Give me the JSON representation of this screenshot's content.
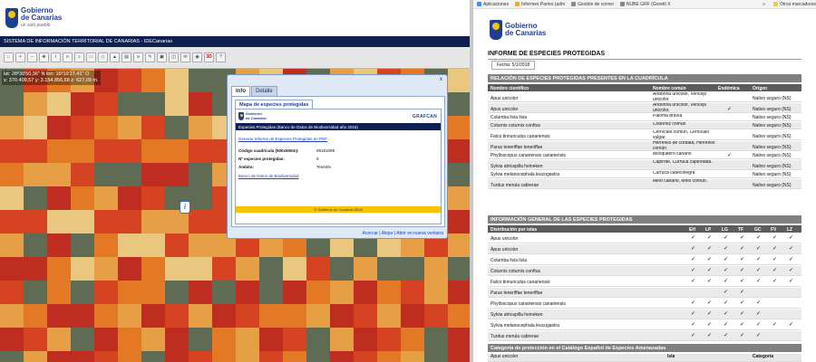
{
  "left_app": {
    "logo": {
      "line1": "Gobierno",
      "line2": "de Canarias",
      "tagline": "un solo pueblo"
    },
    "system_bar": "SISTEMA DE INFORMACIÓN TERRITORIAL DE CANARIAS - IDECanarias",
    "coords": {
      "line1": "lat: 28º30'50,36'' N  lon: 16º19'27,41'' O",
      "line2": "x: 370.409,57  y: 3.154.856,68  z: 627,09 m."
    },
    "toolbar_3d": "3D",
    "popup": {
      "tabs": [
        "Info",
        "Detalle"
      ],
      "inner_tab": "Mapa de especies protegidas",
      "logo_line1": "Gobierno",
      "logo_line2": "de Canarias",
      "brand": "GRAFCAN",
      "banner": "Especies Protegidas (Banco de Datos de Biodiversidad año 2016)",
      "report_link": "Generar Informe de Especies Protegidas en PDF",
      "fields": [
        {
          "label": "Código cuadrícula (500x500m):",
          "value": "09181099"
        },
        {
          "label": "Nº especies protegidas:",
          "value": "9"
        },
        {
          "label": "Ámbito:",
          "value": "Tenerife"
        }
      ],
      "db_link": "Banco de Datos de Biodiversidad",
      "footer": "© Gobierno de Canarias 2018",
      "actions": "Acercar | Alejar | Abrir en nueva ventana",
      "close": "x"
    }
  },
  "browser": {
    "bookmarks": [
      "Aplicaciones",
      "Informes Partes (adm",
      "Gestión de correo",
      "NUBE GRF (Goretti X",
      "Otros marcadores"
    ],
    "more": "»"
  },
  "report": {
    "logo_line1": "Gobierno",
    "logo_line2": "de Canarias",
    "title": "INFORME DE ESPECIES PROTEGIDAS",
    "date": "Fecha: 5/1/2018",
    "section1": "RELACIÓN DE ESPECIES PROTEGIDAS PRESENTES EN LA CUADRÍCULA",
    "section1_headers": [
      "Nombre científico",
      "Nombre común",
      "Endémica",
      "Origen"
    ],
    "species": [
      {
        "sci": "Apus unicolor",
        "common": "Andoriña unicolor, Vencejo unicolor.",
        "endemic": "",
        "origin": "Nativo seguro (NS)"
      },
      {
        "sci": "Apus unicolor",
        "common": "Andoriña unicolor, Vencejo unicolor.",
        "endemic": "✓",
        "origin": "Nativo seguro (NS)"
      },
      {
        "sci": "Columba livia livia",
        "common": "Paloma bravía",
        "endemic": "",
        "origin": "Nativo seguro (NS)"
      },
      {
        "sci": "Coturnix coturnix confisa",
        "common": "Codorniz común",
        "endemic": "",
        "origin": "Nativo seguro (NS)"
      },
      {
        "sci": "Falco tinnunculus canariensis",
        "common": "Cernícalo común, Cernícalo vulgar.",
        "endemic": "",
        "origin": "Nativo seguro (NS)"
      },
      {
        "sci": "Parus teneriffae teneriffae",
        "common": "Herrerillo de corbata, Herrerillo común",
        "endemic": "",
        "origin": "Nativo seguro (NS)"
      },
      {
        "sci": "Phylloscopus canariensis canariensis",
        "common": "Mosquitero canario",
        "endemic": "✓",
        "origin": "Nativo seguro (NS)"
      },
      {
        "sci": "Sylvia atricapilla heineken",
        "common": "Capirote, Curruca capirotada.",
        "endemic": "",
        "origin": "Nativo seguro (NS)"
      },
      {
        "sci": "Sylvia melanocephala leucogastra",
        "common": "Curruca cabecinegra",
        "endemic": "",
        "origin": "Nativo seguro (NS)"
      },
      {
        "sci": "Turdus merula cabrerae",
        "common": "Mirlo canario, Mirlo común.",
        "endemic": "",
        "origin": "Nativo seguro (NS)"
      }
    ],
    "section2": "INFORMACIÓN GENERAL DE LAS ESPECIES PROTEGIDAS",
    "section2_header": "Distribución por islas",
    "islands": [
      "EH",
      "LP",
      "LG",
      "TF",
      "GC",
      "FV",
      "LZ"
    ],
    "distribution": [
      {
        "sci": "Apus unicolor",
        "marks": [
          "✓",
          "✓",
          "✓",
          "✓",
          "✓",
          "✓",
          "✓"
        ]
      },
      {
        "sci": "Apus unicolor",
        "marks": [
          "✓",
          "✓",
          "✓",
          "✓",
          "✓",
          "✓",
          "✓"
        ]
      },
      {
        "sci": "Columba livia livia",
        "marks": [
          "✓",
          "✓",
          "✓",
          "✓",
          "✓",
          "✓",
          "✓"
        ]
      },
      {
        "sci": "Coturnix coturnix confisa",
        "marks": [
          "✓",
          "✓",
          "✓",
          "✓",
          "✓",
          "✓",
          "✓"
        ]
      },
      {
        "sci": "Falco tinnunculus canariensis",
        "marks": [
          "✓",
          "✓",
          "✓",
          "✓",
          "✓",
          "✓",
          "✓"
        ]
      },
      {
        "sci": "Parus teneriffae teneriffae",
        "marks": [
          "",
          "",
          "✓",
          "✓",
          "",
          "",
          ""
        ]
      },
      {
        "sci": "Phylloscopus canariensis canariensis",
        "marks": [
          "✓",
          "✓",
          "✓",
          "✓",
          "✓",
          "",
          ""
        ]
      },
      {
        "sci": "Sylvia atricapilla heineken",
        "marks": [
          "✓",
          "✓",
          "✓",
          "✓",
          "✓",
          "",
          ""
        ]
      },
      {
        "sci": "Sylvia melanocephala leucogastra",
        "marks": [
          "✓",
          "✓",
          "✓",
          "✓",
          "✓",
          "✓",
          "✓"
        ]
      },
      {
        "sci": "Turdus merula cabrerae",
        "marks": [
          "✓",
          "✓",
          "✓",
          "✓",
          "✓",
          "",
          ""
        ]
      }
    ],
    "section3": "Categoría de protección en el Catálogo Español de Especies Amenazadas",
    "section3_headers": [
      "Isla",
      "Categoría"
    ],
    "section3_first": "Apus unicolor"
  },
  "map_colors": {
    "dark_red": "#c8281c",
    "red": "#e0401f",
    "orange": "#ef7a22",
    "light_orange": "#f3a444",
    "yellow": "#f6cf82"
  }
}
